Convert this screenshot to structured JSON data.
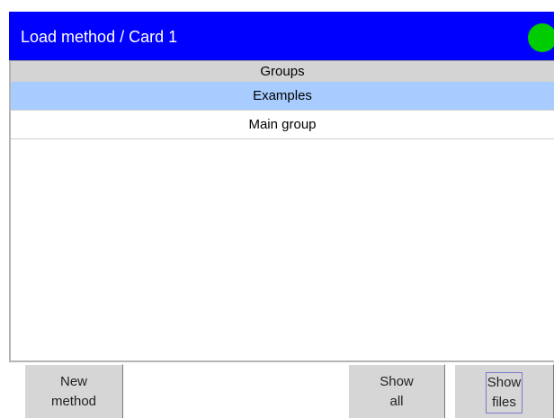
{
  "window": {
    "title": "Load method / Card 1",
    "status_color": "#00cc00"
  },
  "groups": {
    "header": "Groups",
    "items": [
      {
        "label": "Examples",
        "selected": true
      },
      {
        "label": "Main group",
        "selected": false
      }
    ]
  },
  "toolbar": {
    "new_method": {
      "line1": "New",
      "line2": "method"
    },
    "show_all": {
      "line1": "Show",
      "line2": "all"
    },
    "show_files": {
      "line1": "Show",
      "line2": "files"
    }
  },
  "colors": {
    "titlebar": "#0000ff",
    "selected_row": "#a8ccff",
    "header_bg": "#d4d4d4",
    "button_bg": "#d6d6d6"
  }
}
